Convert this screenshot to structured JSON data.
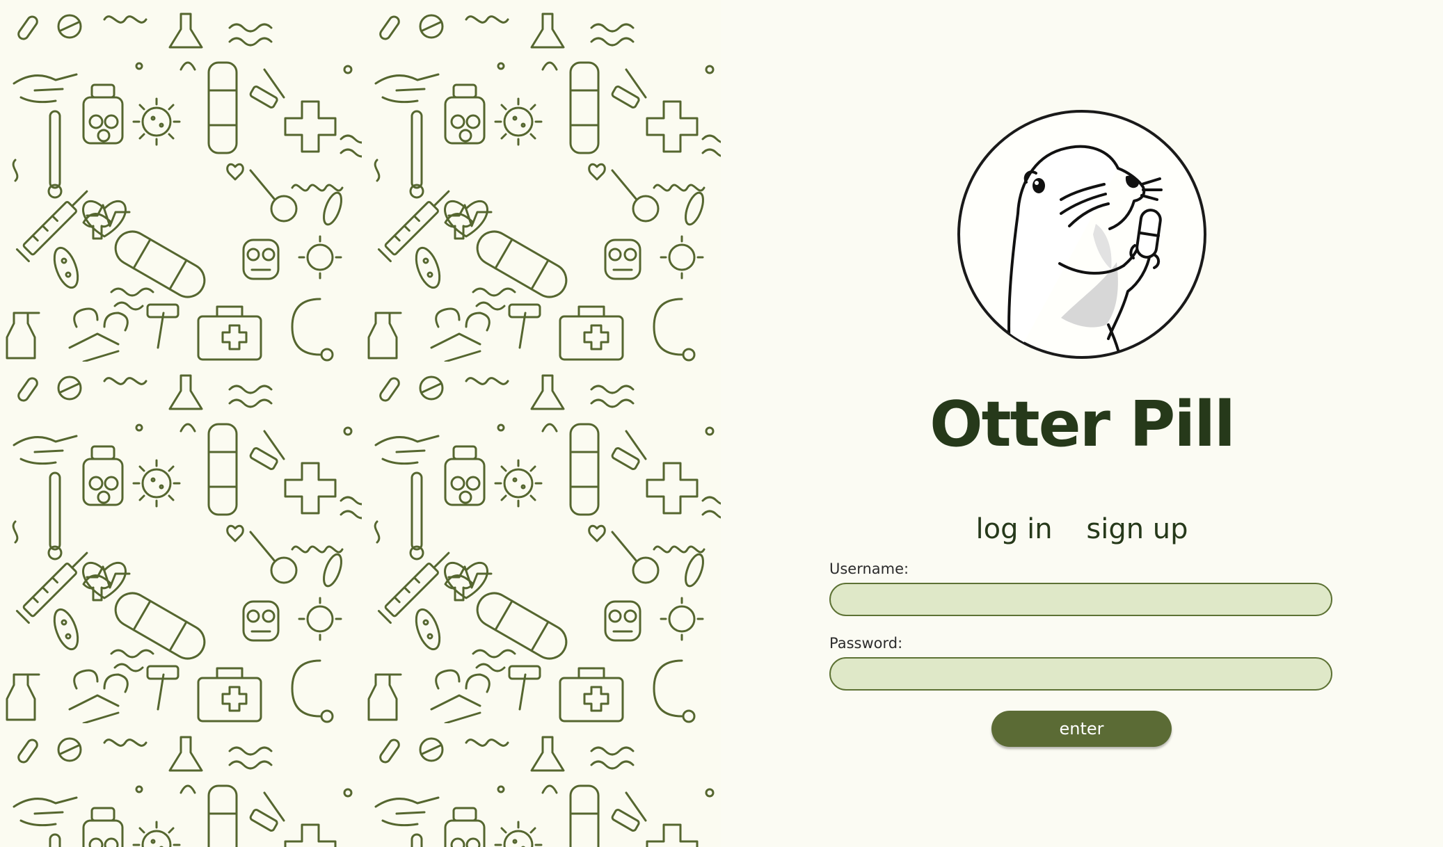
{
  "app": {
    "title": "Otter Pill"
  },
  "auth_tabs": {
    "login_label": "log in",
    "signup_label": "sign up"
  },
  "form": {
    "username_label": "Username:",
    "username_value": "",
    "password_label": "Password:",
    "password_value": "",
    "submit_label": "enter"
  },
  "icons": {
    "logo": "otter-holding-pill-logo",
    "background": "medical-doodle-pattern"
  },
  "colors": {
    "page_background": "#fbfbf3",
    "primary_dark": "#26391a",
    "input_fill": "#dfe8c8",
    "input_border": "#5d7234",
    "button_fill": "#5b6b35",
    "pattern_stroke": "#55662f"
  }
}
